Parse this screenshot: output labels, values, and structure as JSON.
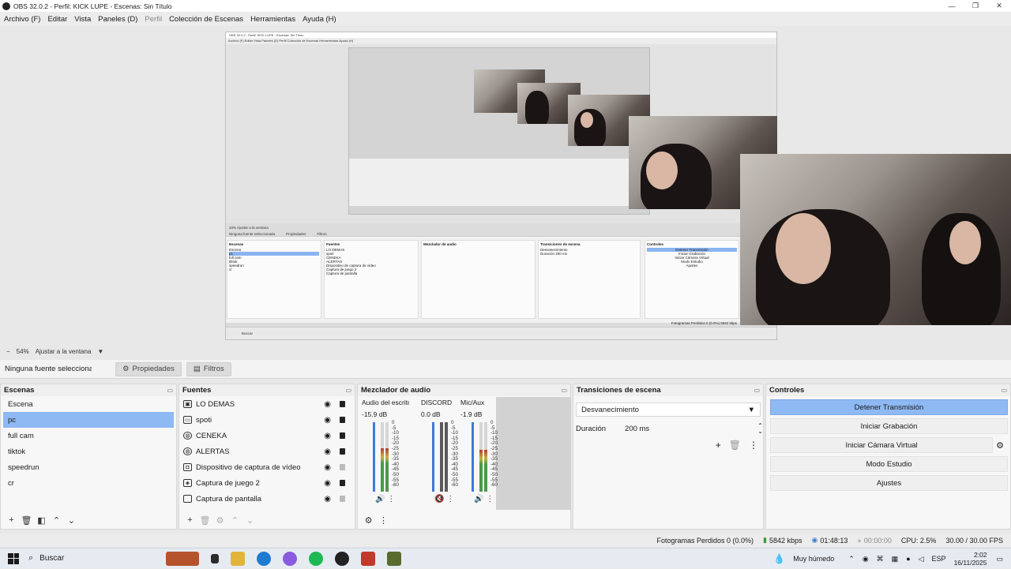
{
  "window": {
    "title": "OBS 32.0.2 - Perfil: KICK LUPE - Escenas: Sin Título",
    "min": "—",
    "max": "❐",
    "close": "✕"
  },
  "menu": [
    "Archivo (F)",
    "Editar",
    "Vista",
    "Paneles (D)",
    "Perfil",
    "Colección de Escenas",
    "Herramientas",
    "Ayuda (H)"
  ],
  "nested": {
    "title": "OBS 32.0.2 - Perfil: KICK LUPE - Escenas: Sin Título",
    "menu": "Archivo (F)   Editar   Vista   Paneles (D)   Perfil   Colección de Escenas   Herramientas   Ayuda (H)",
    "zoom": "34%   Ajustar a la ventana",
    "no_source": "Ninguna fuente seleccionada",
    "props": "Propiedades",
    "filters": "Filtros",
    "scenes_title": "Escenas",
    "sources_title": "Fuentes",
    "mixer_title": "Mezclador de audio",
    "transitions_title": "Transiciones de escena",
    "controls_title": "Controles",
    "scenes": [
      "Escena",
      "pc",
      "full cam",
      "tiktok",
      "speedrun",
      "cr"
    ],
    "sources": [
      "LO DEMAS",
      "spoti",
      "CENEKA",
      "ALERTAS",
      "Dispositivo de captura de vídeo",
      "Captura de juego 2",
      "Captura de pantalla"
    ],
    "transition": "Desvanecimiento",
    "duration": "Duración   200 ms",
    "controls": [
      "Detener Transmisión",
      "Iniciar Grabación",
      "Iniciar Cámara Virtual",
      "Modo Estudio",
      "Ajustes"
    ],
    "taskbar": "Buscar",
    "status": "Fotogramas Perdidos 0 (0.0%)   5842 kbps"
  },
  "zoom": {
    "value": "54%",
    "fit": "Ajustar a la ventana"
  },
  "source_bar": {
    "no_source": "Ninguna fuente seleccionac",
    "properties": "Propiedades",
    "filters": "Filtros"
  },
  "scenes": {
    "title": "Escenas",
    "items": [
      "Escena",
      "pc",
      "full cam",
      "tiktok",
      "speedrun",
      "cr"
    ],
    "selected": "pc"
  },
  "sources": {
    "title": "Fuentes",
    "items": [
      {
        "label": "LO DEMAS",
        "icon": "group-icon",
        "locked": true
      },
      {
        "label": "spoti",
        "icon": "window-icon",
        "locked": true
      },
      {
        "label": "CENEKA",
        "icon": "browser-icon",
        "locked": true
      },
      {
        "label": "ALERTAS",
        "icon": "browser-icon",
        "locked": true
      },
      {
        "label": "Dispositivo de captura de vídeo",
        "icon": "camera-icon",
        "locked": false
      },
      {
        "label": "Captura de juego 2",
        "icon": "gamepad-icon",
        "locked": true
      },
      {
        "label": "Captura de pantalla",
        "icon": "monitor-icon",
        "locked": false
      }
    ]
  },
  "mixer": {
    "title": "Mezclador de audio",
    "channels": [
      {
        "name": "Audio del escritorio",
        "db": "-15.9 dB",
        "level": 0.62,
        "muted": false
      },
      {
        "name": "DISCORD",
        "db": "0.0 dB",
        "level": 0.0,
        "muted": true
      },
      {
        "name": "Mic/Aux",
        "db": "-1.9 dB",
        "level": 0.6,
        "muted": false
      }
    ],
    "scale": [
      "0",
      "-5",
      "-10",
      "-15",
      "-20",
      "-25",
      "-30",
      "-35",
      "-40",
      "-45",
      "-50",
      "-55",
      "-60"
    ]
  },
  "transitions": {
    "title": "Transiciones de escena",
    "selected": "Desvanecimiento",
    "duration_label": "Duración",
    "duration_value": "200 ms"
  },
  "controls": {
    "title": "Controles",
    "stop_stream": "Detener Transmisión",
    "start_record": "Iniciar Grabación",
    "virtual_cam": "Iniciar Cámara Virtual",
    "studio": "Modo Estudio",
    "settings": "Ajustes"
  },
  "status": {
    "dropped": "Fotogramas Perdidos 0 (0.0%)",
    "bitrate": "5842 kbps",
    "stream_time": "01:48:13",
    "rec_time": "00:00:00",
    "cpu": "CPU: 2.5%",
    "fps": "30.00 / 30.00 FPS"
  },
  "taskbar": {
    "search": "Buscar",
    "weather": "Muy húmedo",
    "lang": "ESP",
    "time": "2:02",
    "date": "16/11/2025"
  },
  "colors": {
    "accent": "#8eb9f3",
    "meter_green": "#4a9a4a",
    "meter_red": "#b33a3a",
    "muted_red": "#c0392b"
  }
}
